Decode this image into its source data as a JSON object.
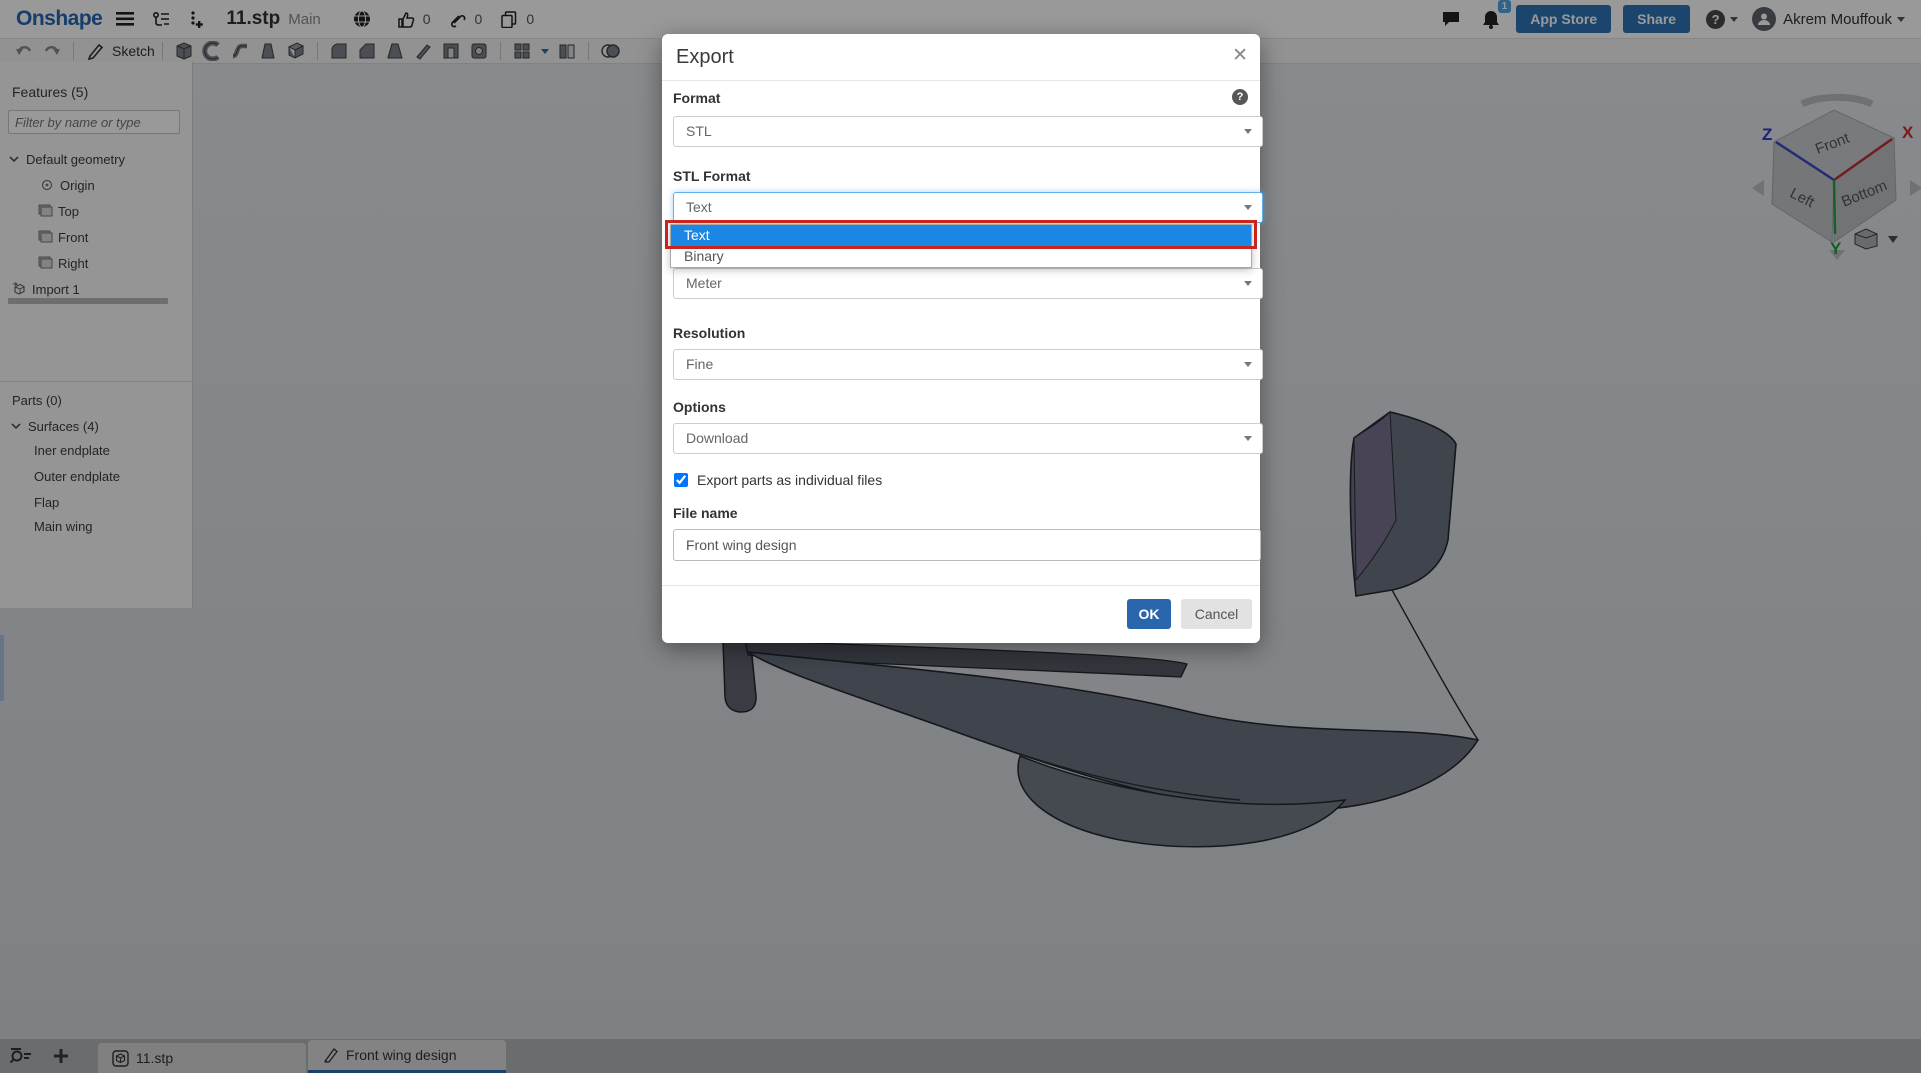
{
  "header": {
    "logo_text": "Onshape",
    "document_name": "11.stp",
    "workspace_name": "Main",
    "like_count": "0",
    "link_count": "0",
    "copy_count": "0",
    "notification_count": "1",
    "app_store_button": "App Store",
    "share_button": "Share",
    "user_name": "Akrem Mouffouk"
  },
  "toolbar": {
    "sketch_button": "Sketch"
  },
  "features_panel": {
    "title": "Features (5)",
    "filter_placeholder": "Filter by name or type",
    "items": [
      {
        "label": "Default geometry"
      },
      {
        "label": "Origin"
      },
      {
        "label": "Top"
      },
      {
        "label": "Front"
      },
      {
        "label": "Right"
      },
      {
        "label": "Import 1"
      }
    ]
  },
  "parts_panel": {
    "title": "Parts (0)",
    "group_label": "Surfaces (4)",
    "surfaces": [
      "Iner endplate",
      "Outer endplate",
      "Flap",
      "Main wing"
    ]
  },
  "export_dialog": {
    "title": "Export",
    "format_label": "Format",
    "format_value": "STL",
    "stl_format_label": "STL Format",
    "stl_format_value": "Text",
    "dropdown_options": [
      "Text",
      "Binary"
    ],
    "units_value": "Meter",
    "resolution_label": "Resolution",
    "resolution_value": "Fine",
    "options_label": "Options",
    "options_value": "Download",
    "checkbox_label": "Export parts as individual files",
    "checkbox_checked": true,
    "file_name_label": "File name",
    "file_name_value": "Front wing design",
    "ok_button": "OK",
    "cancel_button": "Cancel"
  },
  "view_cube": {
    "front_face": "Front",
    "left_face": "Left",
    "bottom_face": "Bottom",
    "axis_x": "X",
    "axis_y": "Y",
    "axis_z": "Z"
  },
  "tab_bar": {
    "tabs": [
      {
        "label": "11.stp",
        "active": false
      },
      {
        "label": "Front wing design",
        "active": true
      }
    ]
  },
  "colors": {
    "logo_blue": "#2667b3",
    "accent_button_blue": "#3073b6",
    "ok_button_blue": "#2a66ac",
    "dropdown_highlight_blue": "#1b86e4",
    "annotation_red": "#c8251f",
    "active_tab_underline": "#2e6cb5",
    "focus_border_blue": "#66afe9"
  }
}
